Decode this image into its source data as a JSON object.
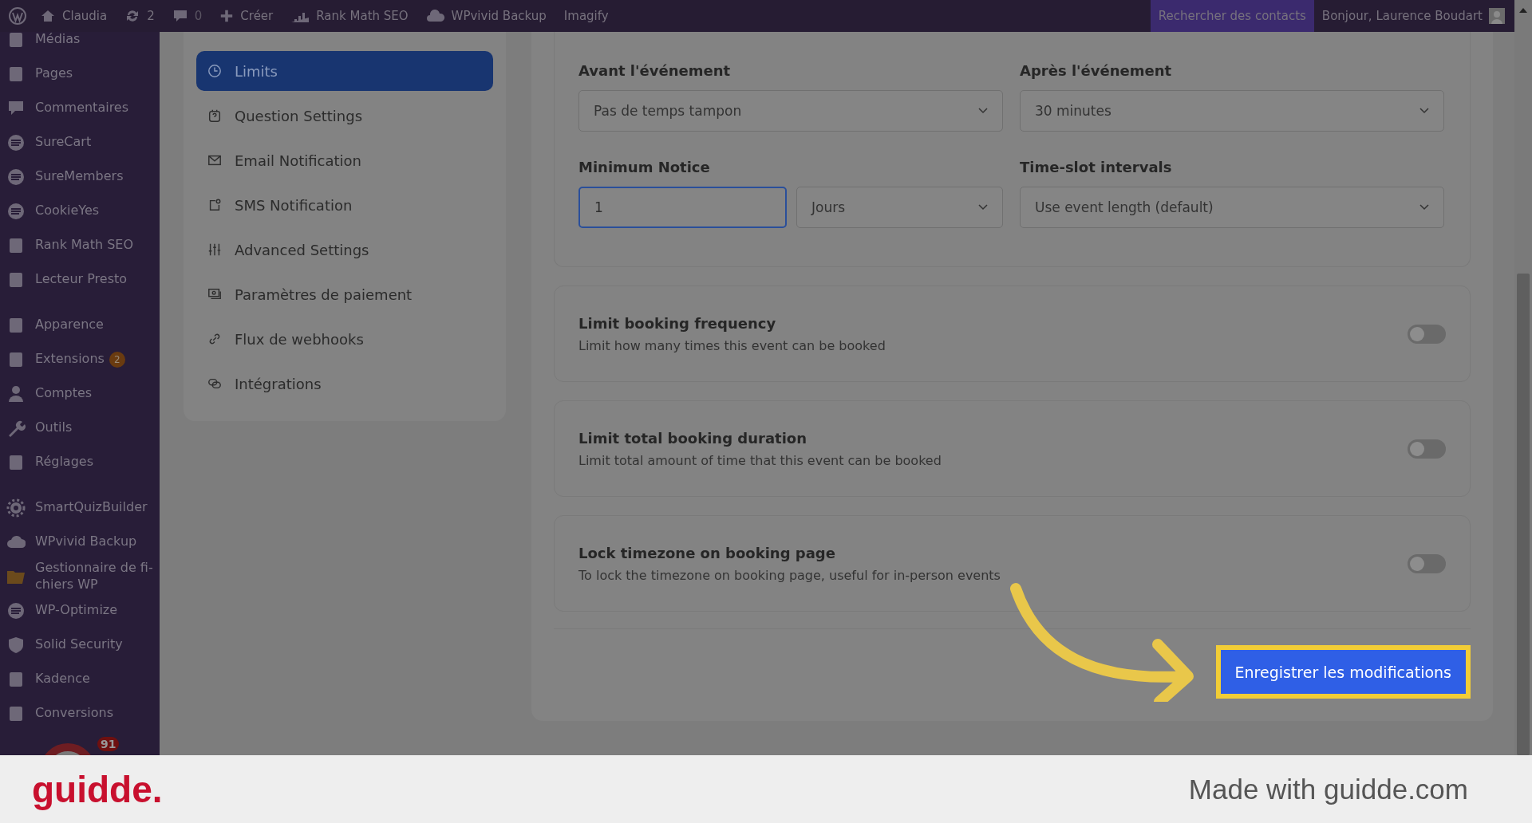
{
  "admin_bar": {
    "items": [
      {
        "label": "Claudia"
      },
      {
        "label": "2"
      },
      {
        "label": "0"
      },
      {
        "label": "Créer"
      },
      {
        "label": "Rank Math SEO"
      },
      {
        "label": "WPvivid Backup"
      },
      {
        "label": "Imagify"
      }
    ],
    "search": "Rechercher des contacts",
    "greeting": "Bonjour, Laurence Boudart"
  },
  "sidebar": {
    "groups": [
      [
        {
          "label": "Médias"
        },
        {
          "label": "Pages"
        },
        {
          "label": "Commentaires"
        },
        {
          "label": "SureCart"
        },
        {
          "label": "SureMembers"
        },
        {
          "label": "CookieYes"
        },
        {
          "label": "Rank Math SEO"
        },
        {
          "label": "Lecteur Presto"
        }
      ],
      [
        {
          "label": "Apparence"
        },
        {
          "label": "Extensions",
          "badge": "2"
        },
        {
          "label": "Comptes"
        },
        {
          "label": "Outils"
        },
        {
          "label": "Réglages"
        }
      ],
      [
        {
          "label": "SmartQuizBuilder"
        },
        {
          "label": "WPvivid Backup"
        },
        {
          "label": "Gestionnaire de fi-\nchiers WP"
        },
        {
          "label": "WP-Optimize"
        },
        {
          "label": "Solid Security"
        },
        {
          "label": "Kadence"
        },
        {
          "label": "Conversions"
        }
      ]
    ],
    "chat_badge": "91"
  },
  "settings_menu": [
    {
      "label": "Limits",
      "selected": true
    },
    {
      "label": "Question Settings",
      "selected": false
    },
    {
      "label": "Email Notification",
      "selected": false
    },
    {
      "label": "SMS Notification",
      "selected": false
    },
    {
      "label": "Advanced Settings",
      "selected": false
    },
    {
      "label": "Paramètres de paiement",
      "selected": false
    },
    {
      "label": "Flux de webhooks",
      "selected": false
    },
    {
      "label": "Intégrations",
      "selected": false
    }
  ],
  "buffer": {
    "before": {
      "label": "Avant l'événement",
      "value": "Pas de temps tampon"
    },
    "after": {
      "label": "Après l'événement",
      "value": "30 minutes"
    }
  },
  "minimum_notice": {
    "label": "Minimum Notice",
    "value": "1",
    "unit": "Jours"
  },
  "time_slot": {
    "label": "Time-slot intervals",
    "value": "Use event length (default)"
  },
  "toggles": [
    {
      "title": "Limit booking frequency",
      "description": "Limit how many times this event can be booked",
      "on": false
    },
    {
      "title": "Limit total booking duration",
      "description": "Limit total amount of time that this event can be booked",
      "on": false
    },
    {
      "title": "Lock timezone on booking page",
      "description": "To lock the timezone on booking page, useful for in-person events",
      "on": false
    }
  ],
  "save_button": "Enregistrer les modifications",
  "footer": {
    "brand": "guidde.",
    "credit": "Made with guidde.com"
  }
}
